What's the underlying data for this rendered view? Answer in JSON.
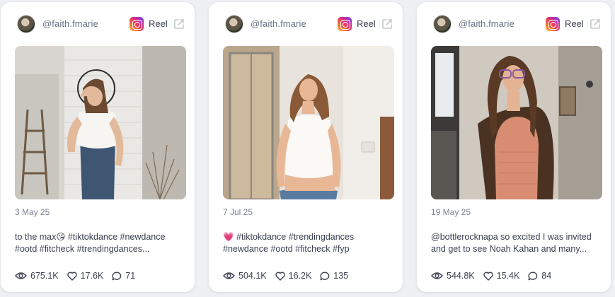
{
  "accent_pink": "#e1306c",
  "posts": [
    {
      "handle": "@faith.fmarie",
      "platform": "Reel",
      "platform_icon": "instagram-icon",
      "date": "3 May 25",
      "caption_line1": "to the max😘 #tiktokdance #newdance",
      "caption_line2": "#ootd #fitcheck #trendingdances...",
      "views": "675.1K",
      "likes": "17.6K",
      "comments": "71"
    },
    {
      "handle": "@faith.fmarie",
      "platform": "Reel",
      "platform_icon": "instagram-icon",
      "date": "7 Jul 25",
      "caption_line1": "💗 #tiktokdance #trendingdances",
      "caption_line2": "#newdance #ootd #fitcheck #fyp",
      "views": "504.1K",
      "likes": "16.2K",
      "comments": "135"
    },
    {
      "handle": "@faith.fmarie",
      "platform": "Reel",
      "platform_icon": "instagram-icon",
      "date": "19 May 25",
      "caption_line1": "@bottlerocknapa so excited I was invited",
      "caption_line2": "and get to see Noah Kahan and many...",
      "views": "544.8K",
      "likes": "15.4K",
      "comments": "84"
    }
  ]
}
